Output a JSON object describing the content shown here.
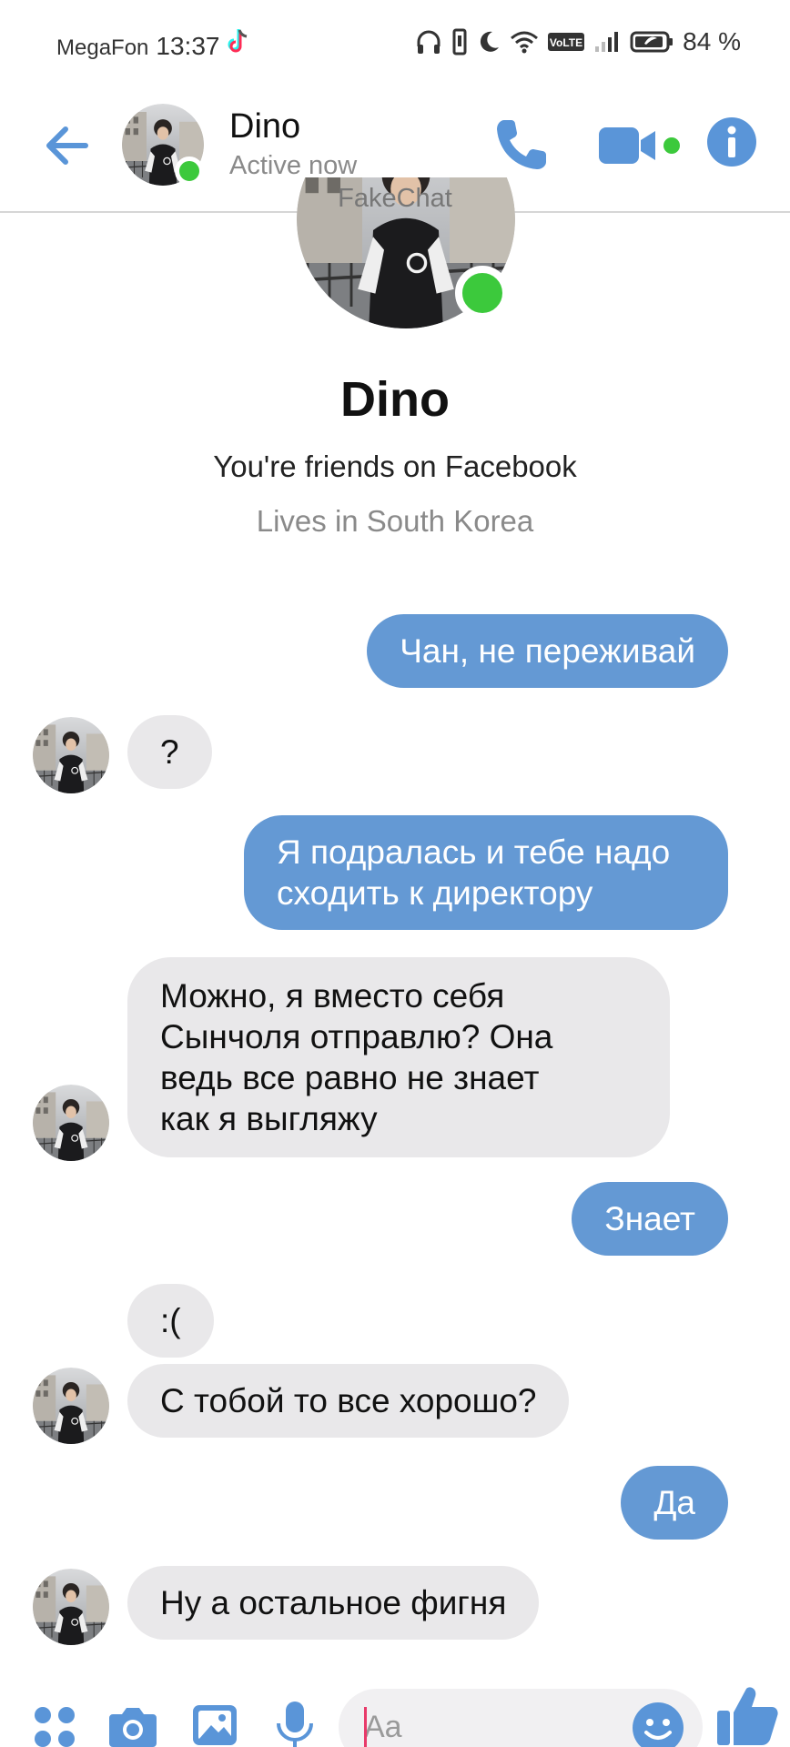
{
  "status_bar": {
    "carrier": "MegaFon",
    "time": "13:37",
    "network_badge": "VoLTE",
    "battery": "84 %",
    "icons": [
      "tiktok-icon",
      "headphones-icon",
      "vibrate-icon",
      "moon-icon",
      "wifi-icon",
      "signal-icon",
      "battery-icon"
    ]
  },
  "header": {
    "name": "Dino",
    "status": "Active now",
    "icons": [
      "back-arrow-icon",
      "phone-icon",
      "video-camera-icon",
      "info-icon"
    ],
    "accent": "#6499d4",
    "online_color": "#3cc93c"
  },
  "watermark": "FakeChat",
  "profile": {
    "name": "Dino",
    "friends_text": "You're friends on Facebook",
    "location_text": "Lives in South Korea"
  },
  "messages": [
    {
      "from": "me",
      "text": "Чан, не переживай"
    },
    {
      "from": "them",
      "text": "?"
    },
    {
      "from": "me",
      "text": "Я подралась и тебе надо\nсходить к директору"
    },
    {
      "from": "them",
      "text": "Можно, я вместо себя\nСынчоля отправлю? Она\nведь все равно не знает\nкак я выгляжу"
    },
    {
      "from": "me",
      "text": "Знает"
    },
    {
      "from": "them",
      "text": ":("
    },
    {
      "from": "them",
      "text": "С тобой то все хорошо?"
    },
    {
      "from": "me",
      "text": "Да"
    },
    {
      "from": "them",
      "text": "Ну а остальное фигня"
    }
  ],
  "composer": {
    "placeholder": "Aa",
    "icons": [
      "apps-grid-icon",
      "camera-icon",
      "gallery-icon",
      "microphone-icon",
      "emoji-icon",
      "thumbs-up-icon"
    ]
  },
  "colors": {
    "outgoing_bubble": "#6499d4",
    "incoming_bubble": "#e9e8ea"
  }
}
